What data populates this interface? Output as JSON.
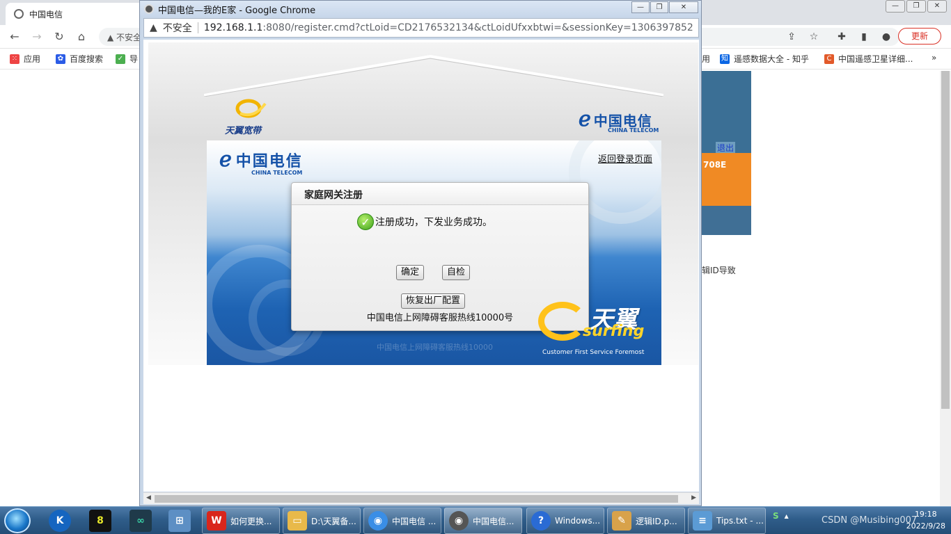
{
  "background_browser": {
    "tab_title": "中国电信",
    "window_buttons": [
      "—",
      "❐",
      "✕"
    ],
    "omnibox_text": "不安全",
    "update_button": "更新",
    "bookmarks": [
      {
        "label": "应用"
      },
      {
        "label": "百度搜索"
      },
      {
        "label": "导"
      },
      {
        "label": "用"
      },
      {
        "label": "遥感数据大全 - 知乎"
      },
      {
        "label": "中国遥感卫星详细..."
      }
    ],
    "more_bookmarks": "»",
    "page_logout": "退出",
    "page_orange_text": "708E",
    "page_side_text": "辑ID导致"
  },
  "popup": {
    "window_title": "中国电信—我的E家 - Google Chrome",
    "window_buttons": [
      "—",
      "❐",
      "✕"
    ],
    "security_label": "不安全",
    "url_host": "192.168.1.1",
    "url_rest": ":8080/register.cmd?ctLoid=CD2176532134&ctLoidUfxxbtwi=&sessionKey=1306397852"
  },
  "router_page": {
    "brand_left": "天翼宽带",
    "telecom_cn": "中国电信",
    "telecom_en": "CHINA TELECOM",
    "back_to_login": "返回登录页面",
    "dialog": {
      "title": "家庭网关注册",
      "message": "注册成功，下发业务成功。",
      "confirm_button": "确定",
      "selfcheck_button": "自检",
      "restore_button": "恢复出厂配置",
      "hotline": "中国电信上网障碍客服热线10000号"
    },
    "ghost_hotline": "中国电信上网障碍客服热线10000",
    "surfing_cn": "天翼",
    "surfing_en": "surfing",
    "slogan": "Customer First Service Foremost"
  },
  "taskbar": {
    "tasks": [
      {
        "label": "如何更换...",
        "color": "#d9261c"
      },
      {
        "label": "D:\\天翼备...",
        "color": "#e8b94a"
      },
      {
        "label": "中国电信 ...",
        "color": "#3a8ee6"
      },
      {
        "label": "中国电信...",
        "color": "#555555"
      },
      {
        "label": "Windows...",
        "color": "#2a6bd4"
      },
      {
        "label": "逻辑ID.p...",
        "color": "#d8a24a"
      },
      {
        "label": "Tips.txt - ...",
        "color": "#5b9bd5"
      }
    ],
    "watermark": "CSDN @Musibing007",
    "time": "19:18",
    "date": "2022/9/28"
  }
}
